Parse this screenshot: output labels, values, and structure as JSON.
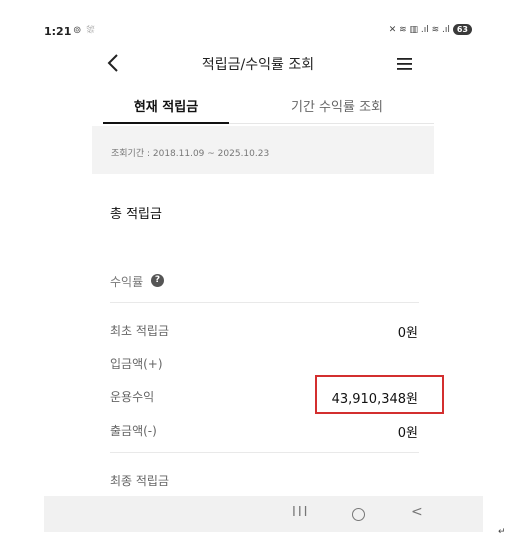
{
  "status_bar": {
    "time": "1:21",
    "left_icons": "⊚ ⛆",
    "right_icons": "✕ ≋ ▥ .ıl ≋ .ıl",
    "battery": "63"
  },
  "header": {
    "title": "적립금/수익률 조회",
    "back_icon": "chevron-left-icon",
    "menu_icon": "hamburger-menu-icon"
  },
  "tabs": [
    {
      "label": "현재 적립금",
      "active": true
    },
    {
      "label": "기간 수익률 조회",
      "active": false
    }
  ],
  "period": {
    "text": "조회기간 : 2018.11.09 ~ 2025.10.23"
  },
  "total": {
    "label": "총 적립금"
  },
  "rate": {
    "label": "수익률",
    "help_icon": "?"
  },
  "rows": [
    {
      "label": "최초 적립금",
      "value": "0원"
    },
    {
      "label": "입금액(+)",
      "value": ""
    },
    {
      "label": "운용수익",
      "value": "43,910,348원"
    },
    {
      "label": "출금액(-)",
      "value": "0원"
    },
    {
      "label": "최종 적립금",
      "value": ""
    }
  ],
  "highlight_color": "#d32f2f",
  "navbar": {
    "recent": "III",
    "back": "<"
  },
  "return_mark": "↵"
}
